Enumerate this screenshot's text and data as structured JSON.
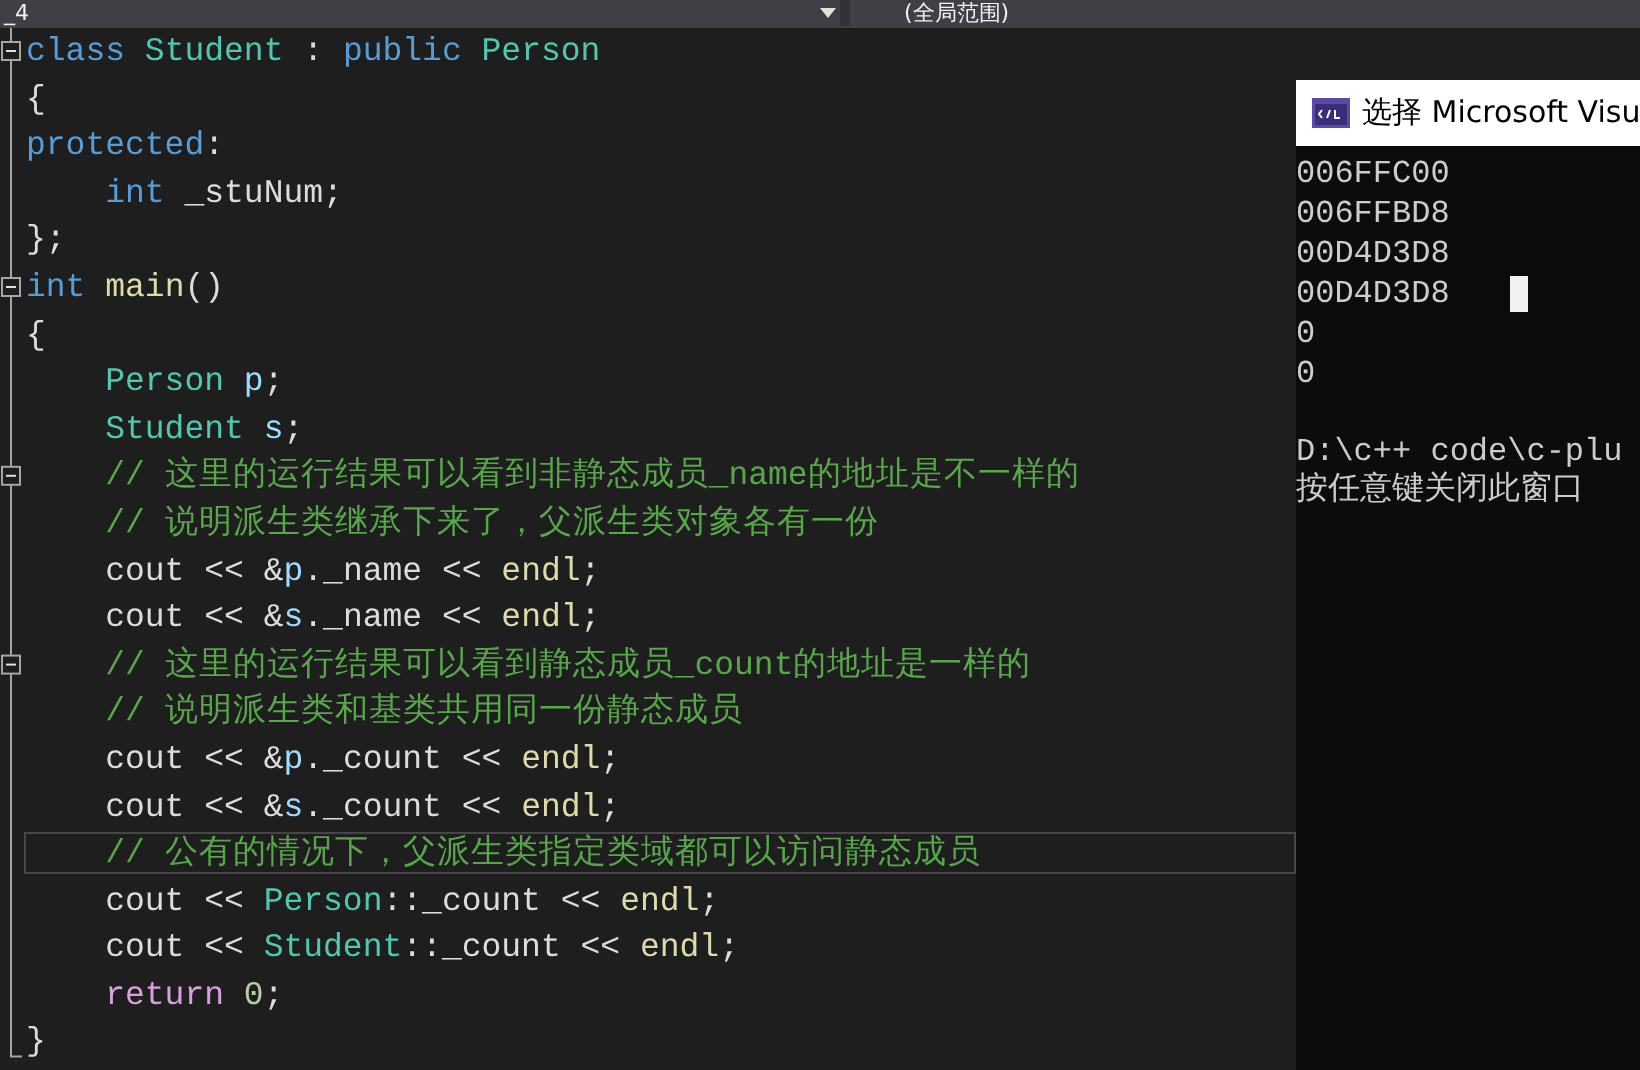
{
  "top_bar": {
    "left_dropdown": "_4",
    "right_dropdown": "(全局范围)"
  },
  "code_lines": [
    {
      "collapsible": true,
      "current": false,
      "tokens": [
        {
          "text": "class ",
          "kind": "keyword"
        },
        {
          "text": "Student",
          "kind": "type"
        },
        {
          "text": " : ",
          "kind": "plain"
        },
        {
          "text": "public ",
          "kind": "keyword"
        },
        {
          "text": "Person",
          "kind": "type"
        }
      ]
    },
    {
      "collapsible": false,
      "current": false,
      "tokens": [
        {
          "text": "{",
          "kind": "plain"
        }
      ]
    },
    {
      "collapsible": false,
      "current": false,
      "tokens": [
        {
          "text": "protected",
          "kind": "keyword"
        },
        {
          "text": ":",
          "kind": "plain"
        }
      ]
    },
    {
      "collapsible": false,
      "current": false,
      "tokens": [
        {
          "text": "    int ",
          "kind": "keyword"
        },
        {
          "text": "_stuNum;",
          "kind": "plain"
        }
      ]
    },
    {
      "collapsible": false,
      "current": false,
      "tokens": [
        {
          "text": "};",
          "kind": "plain"
        }
      ]
    },
    {
      "collapsible": true,
      "current": false,
      "tokens": [
        {
          "text": "int ",
          "kind": "keyword"
        },
        {
          "text": "main",
          "kind": "function"
        },
        {
          "text": "()",
          "kind": "plain"
        }
      ]
    },
    {
      "collapsible": false,
      "current": false,
      "tokens": [
        {
          "text": "{",
          "kind": "plain"
        }
      ]
    },
    {
      "collapsible": false,
      "current": false,
      "tokens": [
        {
          "text": "    Person ",
          "kind": "type"
        },
        {
          "text": "p",
          "kind": "variable"
        },
        {
          "text": ";",
          "kind": "plain"
        }
      ]
    },
    {
      "collapsible": false,
      "current": false,
      "tokens": [
        {
          "text": "    Student ",
          "kind": "type"
        },
        {
          "text": "s",
          "kind": "variable"
        },
        {
          "text": ";",
          "kind": "plain"
        }
      ]
    },
    {
      "collapsible": true,
      "current": false,
      "tokens": [
        {
          "text": "    // 这里的运行结果可以看到非静态成员_name的地址是不一样的",
          "kind": "comment"
        }
      ]
    },
    {
      "collapsible": false,
      "current": false,
      "tokens": [
        {
          "text": "    // 说明派生类继承下来了，父派生类对象各有一份",
          "kind": "comment"
        }
      ]
    },
    {
      "collapsible": false,
      "current": false,
      "tokens": [
        {
          "text": "    cout << &",
          "kind": "plain"
        },
        {
          "text": "p",
          "kind": "variable"
        },
        {
          "text": "._name << ",
          "kind": "plain"
        },
        {
          "text": "endl",
          "kind": "function"
        },
        {
          "text": ";",
          "kind": "plain"
        }
      ]
    },
    {
      "collapsible": false,
      "current": false,
      "tokens": [
        {
          "text": "    cout << &",
          "kind": "plain"
        },
        {
          "text": "s",
          "kind": "variable"
        },
        {
          "text": "._name << ",
          "kind": "plain"
        },
        {
          "text": "endl",
          "kind": "function"
        },
        {
          "text": ";",
          "kind": "plain"
        }
      ]
    },
    {
      "collapsible": true,
      "current": false,
      "tokens": [
        {
          "text": "    // 这里的运行结果可以看到静态成员_count的地址是一样的",
          "kind": "comment"
        }
      ]
    },
    {
      "collapsible": false,
      "current": false,
      "tokens": [
        {
          "text": "    // 说明派生类和基类共用同一份静态成员",
          "kind": "comment"
        }
      ]
    },
    {
      "collapsible": false,
      "current": false,
      "tokens": [
        {
          "text": "    cout << &",
          "kind": "plain"
        },
        {
          "text": "p",
          "kind": "variable"
        },
        {
          "text": "._count << ",
          "kind": "plain"
        },
        {
          "text": "endl",
          "kind": "function"
        },
        {
          "text": ";",
          "kind": "plain"
        }
      ]
    },
    {
      "collapsible": false,
      "current": false,
      "tokens": [
        {
          "text": "    cout << &",
          "kind": "plain"
        },
        {
          "text": "s",
          "kind": "variable"
        },
        {
          "text": "._count << ",
          "kind": "plain"
        },
        {
          "text": "endl",
          "kind": "function"
        },
        {
          "text": ";",
          "kind": "plain"
        }
      ]
    },
    {
      "collapsible": false,
      "current": true,
      "tokens": [
        {
          "text": "    // 公有的情况下，父派生类指定类域都可以访问静态成员",
          "kind": "comment"
        }
      ]
    },
    {
      "collapsible": false,
      "current": false,
      "tokens": [
        {
          "text": "    cout << ",
          "kind": "plain"
        },
        {
          "text": "Person",
          "kind": "type"
        },
        {
          "text": "::_count << ",
          "kind": "plain"
        },
        {
          "text": "endl",
          "kind": "function"
        },
        {
          "text": ";",
          "kind": "plain"
        }
      ]
    },
    {
      "collapsible": false,
      "current": false,
      "tokens": [
        {
          "text": "    cout << ",
          "kind": "plain"
        },
        {
          "text": "Student",
          "kind": "type"
        },
        {
          "text": "::_count << ",
          "kind": "plain"
        },
        {
          "text": "endl",
          "kind": "function"
        },
        {
          "text": ";",
          "kind": "plain"
        }
      ]
    },
    {
      "collapsible": false,
      "current": false,
      "tokens": [
        {
          "text": "    return ",
          "kind": "control"
        },
        {
          "text": "0",
          "kind": "number"
        },
        {
          "text": ";",
          "kind": "plain"
        }
      ]
    },
    {
      "collapsible": false,
      "current": false,
      "tokens": [
        {
          "text": "}",
          "kind": "plain"
        }
      ]
    }
  ],
  "console": {
    "title": "选择 Microsoft Visu",
    "output": [
      {
        "text": "006FFC00",
        "cursor": false
      },
      {
        "text": "006FFBD8",
        "cursor": false
      },
      {
        "text": "00D4D3D8",
        "cursor": false
      },
      {
        "text": "00D4D3D8",
        "cursor": true
      },
      {
        "text": "0",
        "cursor": false
      },
      {
        "text": "0",
        "cursor": false
      }
    ],
    "prompt": [
      "D:\\c++ code\\c-plu",
      "按任意键关闭此窗口"
    ]
  }
}
